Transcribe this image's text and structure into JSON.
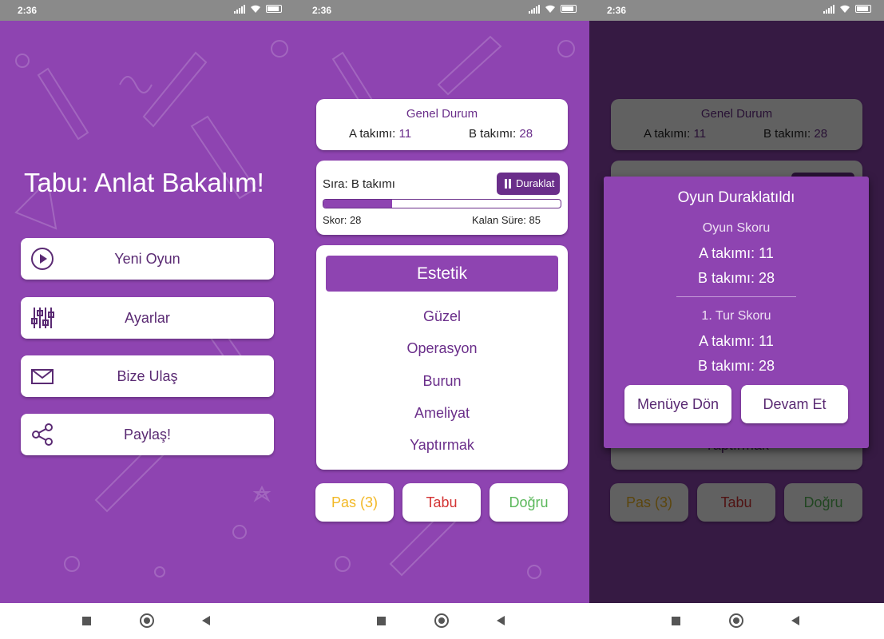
{
  "status_bar": {
    "time": "2:36"
  },
  "colors": {
    "brand": "#8e44b1",
    "accent_dark": "#6a2e8a",
    "pass": "#f2b825",
    "taboo": "#d33434",
    "correct": "#5bb85b"
  },
  "main_menu": {
    "title": "Tabu: Anlat Bakalım!",
    "buttons": [
      {
        "label": "Yeni Oyun",
        "icon": "play-icon"
      },
      {
        "label": "Ayarlar",
        "icon": "sliders-icon"
      },
      {
        "label": "Bize Ulaş",
        "icon": "mail-icon"
      },
      {
        "label": "Paylaş!",
        "icon": "share-icon"
      }
    ]
  },
  "game": {
    "overall": {
      "title": "Genel Durum",
      "team_a_label": "A takımı:",
      "team_a_score": "11",
      "team_b_label": "B takımı:",
      "team_b_score": "28"
    },
    "turn": {
      "label": "Sıra: B takımı",
      "pause_label": "Duraklat",
      "progress": 0.29,
      "score": "Skor: 28",
      "time_left": "Kalan Süre: 85"
    },
    "card": {
      "word": "Estetik",
      "taboo_words": [
        "Güzel",
        "Operasyon",
        "Burun",
        "Ameliyat",
        "Yaptırmak"
      ]
    },
    "actions": {
      "pass": "Pas (3)",
      "taboo": "Tabu",
      "correct": "Doğru"
    }
  },
  "pause_dialog": {
    "title": "Oyun Duraklatıldı",
    "game_score_title": "Oyun Skoru",
    "game_team_a": "A takımı: 11",
    "game_team_b": "B takımı: 28",
    "round_title": "1. Tur Skoru",
    "round_team_a": "A takımı: 11",
    "round_team_b": "B takımı: 28",
    "menu_button": "Menüye Dön",
    "continue_button": "Devam Et"
  }
}
